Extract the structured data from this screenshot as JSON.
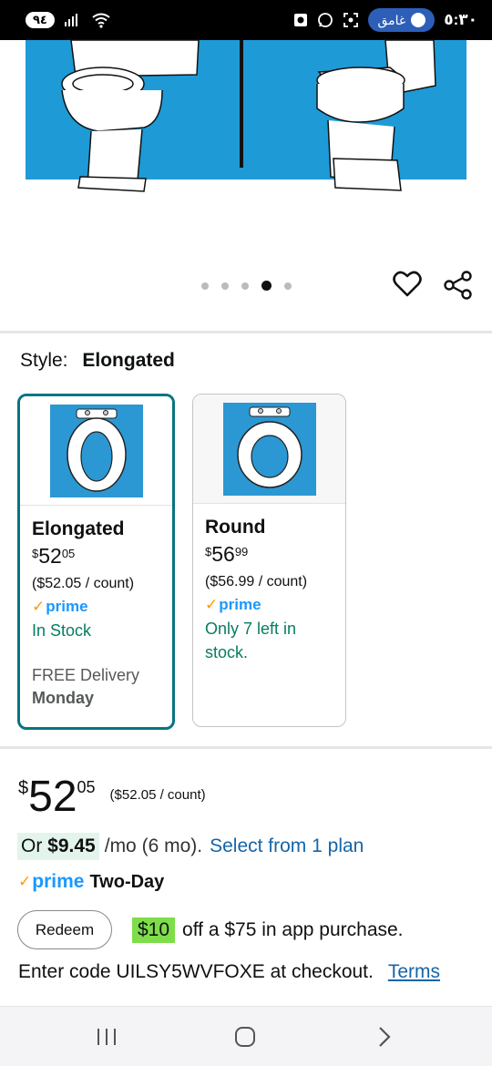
{
  "status_bar": {
    "battery": "٩٤",
    "spotify_label": "غامق",
    "time": "٥:٣٠"
  },
  "hero": {
    "image_dots": 5,
    "active_dot_index": 3
  },
  "style_selector": {
    "label": "Style:",
    "value": "Elongated"
  },
  "variants": [
    {
      "name": "Elongated",
      "price_currency": "$",
      "price_whole": "52",
      "price_fraction": "05",
      "unit_price": "($52.05 / count)",
      "prime_label": "prime",
      "stock": "In Stock",
      "delivery_label": "FREE Delivery",
      "delivery_day": "Monday",
      "selected": true
    },
    {
      "name": "Round",
      "price_currency": "$",
      "price_whole": "56",
      "price_fraction": "99",
      "unit_price": "($56.99 / count)",
      "prime_label": "prime",
      "stock": "Only 7 left in stock.",
      "selected": false
    }
  ],
  "price": {
    "currency": "$",
    "whole": "52",
    "fraction": "05",
    "unit": "($52.05 / count)"
  },
  "installment": {
    "or_label": "Or",
    "amount": "$9.45",
    "term": "/mo (6 mo).",
    "link": "Select from 1 plan"
  },
  "shipping": {
    "prime_label": "prime",
    "speed": "Two-Day"
  },
  "promo": {
    "redeem_label": "Redeem",
    "amount": "$10",
    "text": "off a $75 in app purchase.",
    "code_text": "Enter code UILSY5WVFOXE at checkout.",
    "terms_label": "Terms"
  },
  "colors": {
    "selected_border": "#087481",
    "stock_green": "#067d62",
    "prime_blue": "#1a98ff",
    "prime_orange": "#ff9900",
    "link_blue": "#1565a8",
    "promo_green": "#7fdd4b",
    "image_blue": "#1e9ad6"
  }
}
